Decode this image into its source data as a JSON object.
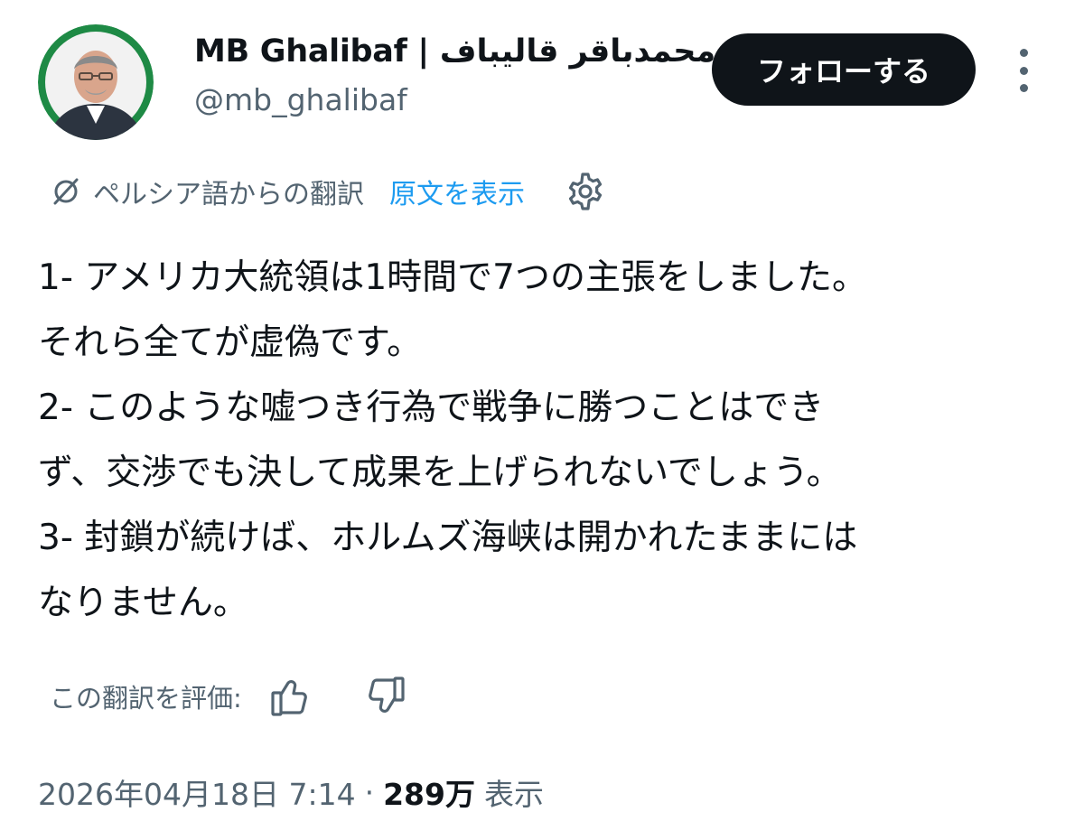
{
  "header": {
    "display_name": "MB Ghalibaf | محمدباقر قالیباف",
    "handle": "@mb_ghalibaf",
    "follow_label": "フォローする"
  },
  "translation": {
    "label": "ペルシア語からの翻訳",
    "show_original_label": "原文を表示"
  },
  "tweet": {
    "lines": [
      "1- アメリカ大統領は1時間で7つの主張をしました。",
      "それら全てが虚偽です。",
      "2- このような嘘つき行為で戦争に勝つことはでき",
      "ず、交渉でも決して成果を上げられないでしょう。",
      "3- 封鎖が続けば、ホルムズ海峡は開かれたままには",
      "なりません。"
    ]
  },
  "rating": {
    "label": "この翻訳を評価:"
  },
  "meta": {
    "timestamp": "2026年04月18日 7:14",
    "separator": "·",
    "views_count": "289万",
    "views_label": "表示"
  },
  "colors": {
    "text": "#0f1419",
    "muted": "#536471",
    "link": "#1d9bf0",
    "follow_bg": "#0f1419",
    "avatar_ring": "#1e8a45"
  },
  "icons": {
    "translate": "translate-slash-icon",
    "settings": "gear-icon",
    "thumb_up": "thumbs-up-icon",
    "thumb_down": "thumbs-down-icon",
    "more": "vertical-dots-icon"
  }
}
